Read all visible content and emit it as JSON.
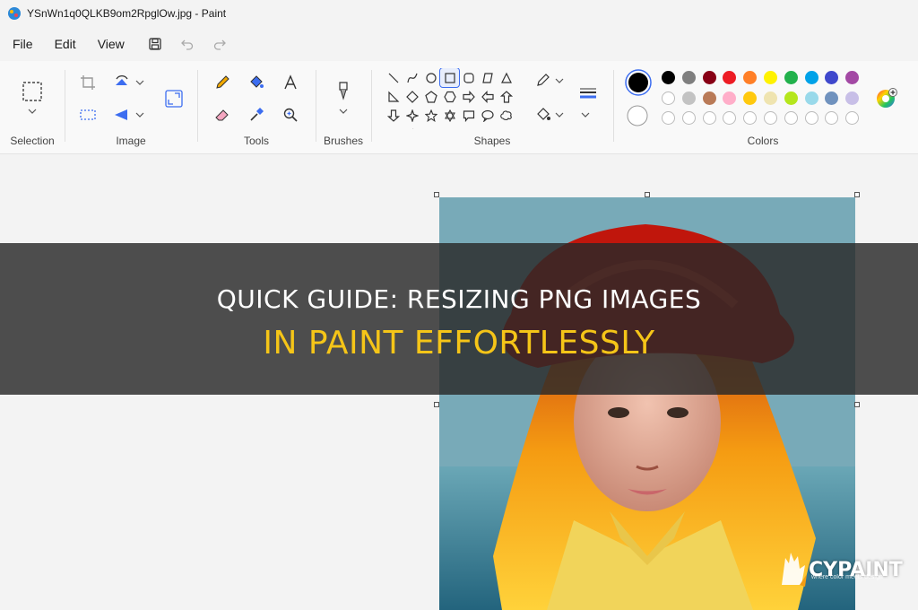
{
  "window": {
    "title": "YSnWn1q0QLKB9om2RpglOw.jpg - Paint"
  },
  "menu": {
    "file": "File",
    "edit": "Edit",
    "view": "View"
  },
  "ribbon": {
    "groups": {
      "selection": "Selection",
      "image": "Image",
      "tools": "Tools",
      "brushes": "Brushes",
      "shapes": "Shapes",
      "colors": "Colors"
    }
  },
  "palette": {
    "row1": [
      "#000000",
      "#7f7f7f",
      "#880015",
      "#ed1c24",
      "#ff7f27",
      "#fff200",
      "#22b14c",
      "#00a2e8",
      "#3f48cc",
      "#a349a4"
    ],
    "row2": [
      "#ffffff",
      "#c3c3c3",
      "#b97a57",
      "#ffaec9",
      "#ffc90e",
      "#efe4b0",
      "#b5e61d",
      "#99d9ea",
      "#7092be",
      "#c8bfe7"
    ],
    "primary": "#000000",
    "secondary": "#ffffff"
  },
  "overlay": {
    "line1": "Quick Guide: Resizing PNG Images",
    "line2": "In Paint Effortlessly"
  },
  "watermark": {
    "brand": "CYPAINT",
    "tagline": "where color meets design"
  }
}
